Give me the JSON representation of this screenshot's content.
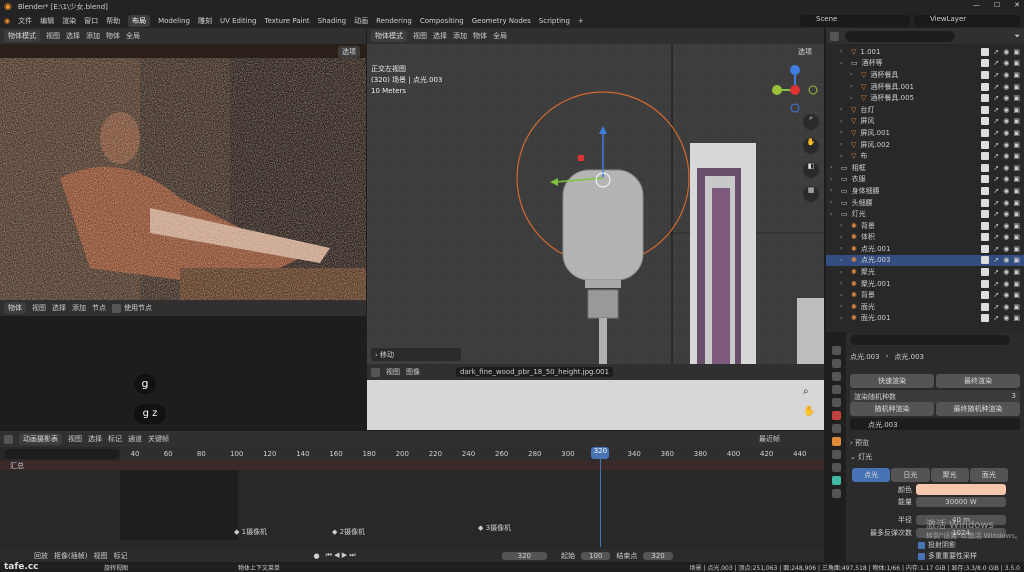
{
  "title": "Blender* [E:\\1\\少女.blend]",
  "menu": [
    "文件",
    "编辑",
    "渲染",
    "窗口",
    "帮助"
  ],
  "workspaces": [
    "布局",
    "Modeling",
    "雕刻",
    "UV Editing",
    "Texture Paint",
    "Shading",
    "动画",
    "Rendering",
    "Compositing",
    "Geometry Nodes",
    "Scripting",
    "+"
  ],
  "scene": "Scene",
  "view_layer": "ViewLayer",
  "left_view": {
    "mode": "物体模式",
    "menus": [
      "视图",
      "选择",
      "添加",
      "物体"
    ],
    "global": "全局",
    "options": "选项"
  },
  "center_view": {
    "mode": "物体模式",
    "menus": [
      "视图",
      "选择",
      "添加",
      "物体"
    ],
    "global": "全局",
    "options": "选项",
    "view_name": "正交左视图",
    "info": "(320) 场景 | 点光.003",
    "scale": "10 Meters",
    "operator_panel": "移动"
  },
  "node_editor": {
    "mode": "物体",
    "menus": [
      "视图",
      "选择",
      "添加",
      "节点"
    ],
    "use_nodes": "使用节点",
    "chars": [
      "g",
      "g z"
    ]
  },
  "image_editor": {
    "menus": [
      "视图",
      "图像"
    ],
    "image_name": "dark_fine_wood_pbr_18_50_height.jpg.001"
  },
  "outliner": {
    "items": [
      {
        "name": "1.001",
        "indent": 1,
        "type": "mesh",
        "selected": false
      },
      {
        "name": "酒杯等",
        "indent": 1,
        "type": "coll",
        "selected": false
      },
      {
        "name": "酒杯餐具",
        "indent": 2,
        "type": "mesh",
        "selected": false
      },
      {
        "name": "酒杯餐具.001",
        "indent": 2,
        "type": "mesh",
        "selected": false
      },
      {
        "name": "酒杯餐具.005",
        "indent": 2,
        "type": "mesh",
        "selected": false
      },
      {
        "name": "台灯",
        "indent": 1,
        "type": "mesh",
        "selected": false
      },
      {
        "name": "屏风",
        "indent": 1,
        "type": "mesh",
        "selected": false
      },
      {
        "name": "屏风.001",
        "indent": 1,
        "type": "mesh",
        "selected": false
      },
      {
        "name": "屏风.002",
        "indent": 1,
        "type": "mesh",
        "selected": false
      },
      {
        "name": "布",
        "indent": 1,
        "type": "mesh",
        "selected": false
      },
      {
        "name": "相框",
        "indent": 0,
        "type": "coll",
        "selected": false
      },
      {
        "name": "衣服",
        "indent": 0,
        "type": "coll",
        "selected": false
      },
      {
        "name": "身体细腰",
        "indent": 0,
        "type": "coll",
        "selected": false
      },
      {
        "name": "头细腰",
        "indent": 0,
        "type": "coll",
        "selected": false
      },
      {
        "name": "灯光",
        "indent": 0,
        "type": "coll",
        "selected": false
      },
      {
        "name": "背景",
        "indent": 1,
        "type": "light",
        "selected": false
      },
      {
        "name": "体积",
        "indent": 1,
        "type": "light",
        "selected": false
      },
      {
        "name": "点光.001",
        "indent": 1,
        "type": "light",
        "selected": false
      },
      {
        "name": "点光.003",
        "indent": 1,
        "type": "light",
        "selected": true
      },
      {
        "name": "聚光",
        "indent": 1,
        "type": "light",
        "selected": false
      },
      {
        "name": "聚光.001",
        "indent": 1,
        "type": "light",
        "selected": false
      },
      {
        "name": "背景",
        "indent": 1,
        "type": "light",
        "selected": false
      },
      {
        "name": "面光",
        "indent": 1,
        "type": "light",
        "selected": false
      },
      {
        "name": "面光.001",
        "indent": 1,
        "type": "light",
        "selected": false
      }
    ]
  },
  "properties": {
    "breadcrumb": [
      "点光.003",
      "点光.003"
    ],
    "quick_render": "快速渲染",
    "final_render": "最终渲染",
    "render_random_label": "渲染随机种数",
    "render_random_value": "3",
    "random_render": "随机种渲染",
    "final_random_render": "最终随机种渲染",
    "data_name": "点光.003",
    "section_preview": "预览",
    "section_light": "灯光",
    "light_types": [
      "点光",
      "日光",
      "聚光",
      "面光"
    ],
    "color_label": "颜色",
    "color_value": "#f7c7ad",
    "power_label": "能量",
    "power_value": "30000 W",
    "radius_label": "半径",
    "radius_value": "40 m",
    "bounces_label": "最多反弹次数",
    "bounces_value": "1024",
    "cast_shadow": "投射阴影",
    "mis": "多重重要性采样",
    "watermark_1": "激活 Windows",
    "watermark_2": "转到\"设置\"以激活 Windows。"
  },
  "timeline": {
    "mode": "动画摄影表",
    "menus": [
      "视图",
      "选择",
      "标记",
      "通道",
      "关键帧"
    ],
    "last_frame_label": "最近帧",
    "ruler": [
      "40",
      "60",
      "80",
      "100",
      "120",
      "140",
      "160",
      "180",
      "200",
      "220",
      "240",
      "260",
      "280",
      "300",
      "320",
      "340",
      "360",
      "380",
      "400",
      "420",
      "440"
    ],
    "current_frame": "320",
    "summary": "汇总",
    "markers": [
      "1摄像机",
      "2摄像机",
      "3摄像机"
    ],
    "bottom_menus": [
      "回放",
      "抠像(插帧)",
      "视图",
      "标记"
    ],
    "frame_value": "320",
    "start_label": "起始",
    "start_value": "100",
    "end_label": "结束点",
    "end_value": "320"
  },
  "status": {
    "left": "旋转视图",
    "mid": "物体上下文菜单",
    "right": "场景 | 点光.003 | 顶点:251,063 | 面:248,906 | 三角面:497,518 | 物体:1/66 | 内存:1.17 GiB | 显存:3.3/8.0 GiB | 3.5.0"
  },
  "logo": "tafe.cc"
}
